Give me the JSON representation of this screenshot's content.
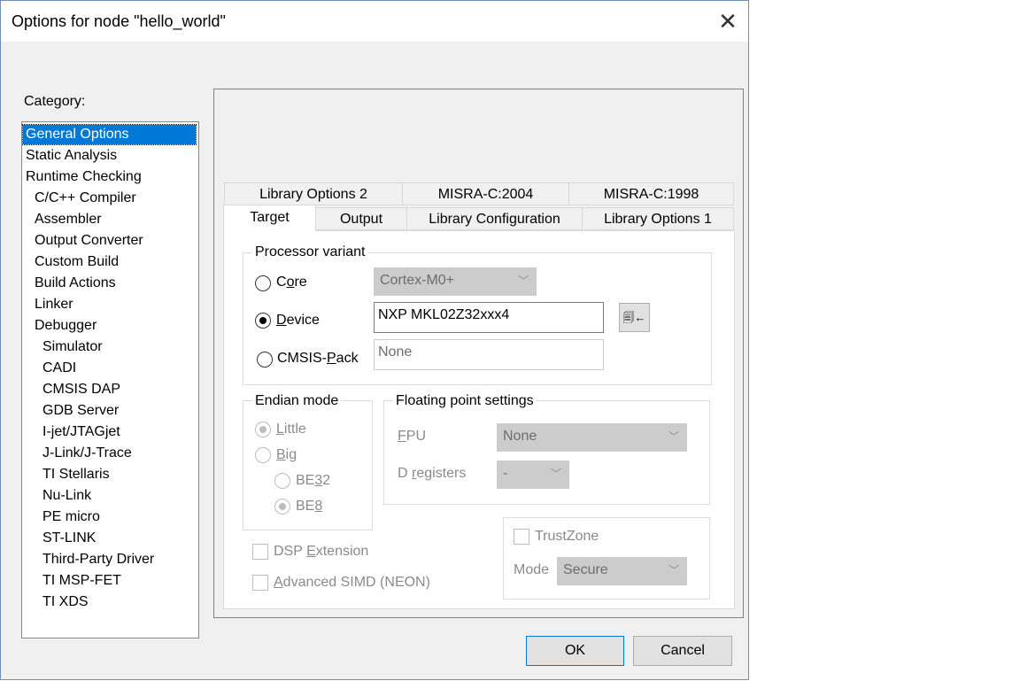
{
  "window": {
    "title": "Options for node \"hello_world\"",
    "close_icon": "close-icon"
  },
  "category": {
    "label": "Category:",
    "items": [
      {
        "label": "General Options",
        "selected": true
      },
      {
        "label": "Static Analysis"
      },
      {
        "label": "Runtime Checking"
      },
      {
        "label": "C/C++ Compiler"
      },
      {
        "label": "Assembler"
      },
      {
        "label": "Output Converter"
      },
      {
        "label": "Custom Build"
      },
      {
        "label": "Build Actions"
      },
      {
        "label": "Linker"
      },
      {
        "label": "Debugger"
      },
      {
        "label": "Simulator"
      },
      {
        "label": "CADI"
      },
      {
        "label": "CMSIS DAP"
      },
      {
        "label": "GDB Server"
      },
      {
        "label": "I-jet/JTAGjet"
      },
      {
        "label": "J-Link/J-Trace"
      },
      {
        "label": "TI Stellaris"
      },
      {
        "label": "Nu-Link"
      },
      {
        "label": "PE micro"
      },
      {
        "label": "ST-LINK"
      },
      {
        "label": "Third-Party Driver"
      },
      {
        "label": "TI MSP-FET"
      },
      {
        "label": "TI XDS"
      }
    ]
  },
  "tabs": {
    "row1": [
      "Library Options 2",
      "MISRA-C:2004",
      "MISRA-C:1998"
    ],
    "row2": [
      "Target",
      "Output",
      "Library Configuration",
      "Library Options 1"
    ],
    "active": "Target"
  },
  "processor_variant": {
    "label": "Processor variant",
    "core": {
      "label_pre": "C",
      "label_u": "o",
      "label_post": "re",
      "value": "Cortex-M0+"
    },
    "device": {
      "label_pre": "",
      "label_u": "D",
      "label_post": "evice",
      "value": "NXP MKL02Z32xxx4",
      "browse_icon": "device-select-icon"
    },
    "cmsis_pack": {
      "label_pre": "CMSIS-",
      "label_u": "P",
      "label_post": "ack",
      "value": "None"
    },
    "selected": "device"
  },
  "endian": {
    "label": "Endian mode",
    "little": {
      "label_pre": "",
      "label_u": "L",
      "label_post": "ittle"
    },
    "big": {
      "label_pre": "",
      "label_u": "B",
      "label_post": "ig"
    },
    "be32": {
      "label_pre": "BE",
      "label_u": "3",
      "label_post": "2"
    },
    "be8": {
      "label_pre": "BE",
      "label_u": "8",
      "label_post": ""
    }
  },
  "fp": {
    "label": "Floating point settings",
    "fpu_label_pre": "",
    "fpu_label_u": "F",
    "fpu_label_post": "PU",
    "fpu_value": "None",
    "dreg_label_pre": "D ",
    "dreg_label_u": "r",
    "dreg_label_post": "egisters",
    "dreg_value": "-"
  },
  "extensions": {
    "dsp": {
      "label_pre": "DSP ",
      "label_u": "E",
      "label_post": "xtension"
    },
    "simd": {
      "label_pre": "",
      "label_u": "A",
      "label_post": "dvanced SIMD (NEON)"
    }
  },
  "trustzone": {
    "label": "TrustZone",
    "mode_label": "Mode",
    "mode_value": "Secure"
  },
  "buttons": {
    "ok": "OK",
    "cancel": "Cancel"
  }
}
